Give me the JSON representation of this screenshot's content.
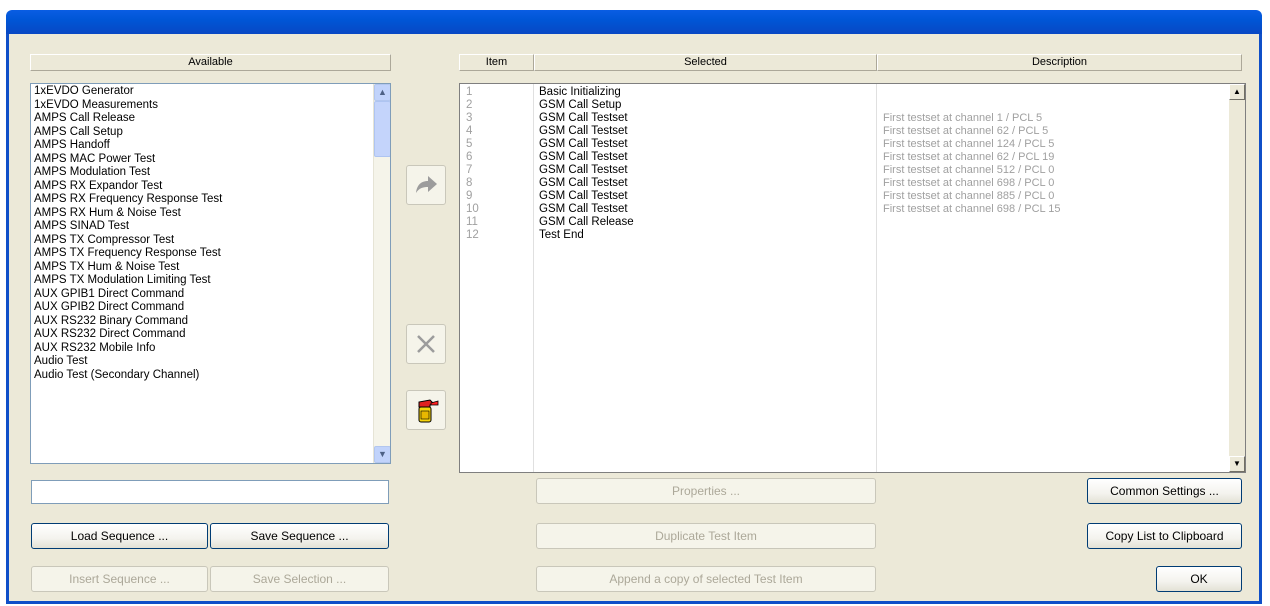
{
  "panels": {
    "available_header": "Available",
    "item_header": "Item",
    "selected_header": "Selected",
    "description_header": "Description"
  },
  "available_items": [
    "1xEVDO Generator",
    "1xEVDO Measurements",
    "AMPS Call Release",
    "AMPS Call Setup",
    "AMPS Handoff",
    "AMPS MAC Power Test",
    "AMPS Modulation Test",
    "AMPS RX Expandor Test",
    "AMPS RX Frequency Response Test",
    "AMPS RX Hum & Noise Test",
    "AMPS SINAD Test",
    "AMPS TX Compressor Test",
    "AMPS TX Frequency Response Test",
    "AMPS TX Hum & Noise Test",
    "AMPS TX Modulation Limiting Test",
    "AUX GPIB1 Direct Command",
    "AUX GPIB2 Direct Command",
    "AUX RS232 Binary Command",
    "AUX RS232 Direct Command",
    "AUX RS232 Mobile Info",
    "Audio Test",
    "Audio Test (Secondary Channel)"
  ],
  "sequence": {
    "items": [
      "1",
      "2",
      "3",
      "4",
      "5",
      "6",
      "7",
      "8",
      "9",
      "10",
      "11",
      "12"
    ],
    "selected": [
      "Basic Initializing",
      "GSM Call Setup",
      "GSM Call Testset",
      "GSM Call Testset",
      "GSM Call Testset",
      "GSM Call Testset",
      "GSM Call Testset",
      "GSM Call Testset",
      "GSM Call Testset",
      "GSM Call Testset",
      "GSM Call Release",
      "Test End"
    ],
    "descriptions": [
      "",
      "",
      "First testset at channel 1 / PCL 5",
      "First testset at channel 62 / PCL 5",
      "First testset at channel 124 / PCL 5",
      "First testset at channel 62 / PCL 19",
      "First testset at channel 512 / PCL 0",
      "First testset at channel 698 / PCL 0",
      "First testset at channel 885 / PCL 0",
      "First testset at channel 698 / PCL 15",
      "",
      ""
    ]
  },
  "buttons": {
    "load_sequence": "Load Sequence ...",
    "save_sequence": "Save Sequence ...",
    "insert_sequence": "Insert Sequence ...",
    "save_selection": "Save Selection ...",
    "properties": "Properties ...",
    "duplicate": "Duplicate Test Item",
    "append_copy": "Append a copy of selected Test Item",
    "common_settings": "Common Settings ...",
    "copy_list": "Copy List to Clipboard",
    "ok": "OK"
  },
  "filter": {
    "value": ""
  }
}
